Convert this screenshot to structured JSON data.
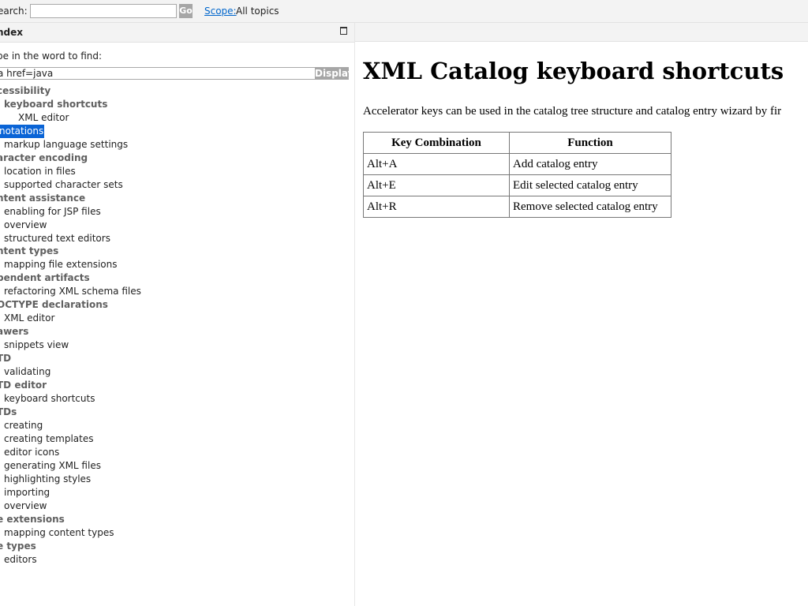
{
  "search_bar": {
    "label": "earch:",
    "input_value": "",
    "go_label": "Go",
    "scope_link": "Scope:",
    "scope_value": "All topics"
  },
  "index": {
    "title": "ndex",
    "prompt": "pe in the word to find:",
    "input_value": "a href=java",
    "display_label": "Display",
    "entries": [
      {
        "text": "cessibility"
      },
      {
        "text": "keyboard shortcuts"
      },
      {
        "text": "XML editor"
      },
      {
        "text": "notations"
      },
      {
        "text": "markup language settings"
      },
      {
        "text": "aracter encoding"
      },
      {
        "text": "location in files"
      },
      {
        "text": "supported character sets"
      },
      {
        "text": "ntent assistance"
      },
      {
        "text": "enabling for JSP files"
      },
      {
        "text": "overview"
      },
      {
        "text": "structured text editors"
      },
      {
        "text": "ntent types"
      },
      {
        "text": "mapping file extensions"
      },
      {
        "text": "pendent artifacts"
      },
      {
        "text": "refactoring XML schema files"
      },
      {
        "text": "OCTYPE declarations"
      },
      {
        "text": "XML editor"
      },
      {
        "text": "awers"
      },
      {
        "text": "snippets view"
      },
      {
        "text": "TD"
      },
      {
        "text": "validating"
      },
      {
        "text": "TD editor"
      },
      {
        "text": "keyboard shortcuts"
      },
      {
        "text": "TDs"
      },
      {
        "text": "creating"
      },
      {
        "text": "creating templates"
      },
      {
        "text": "editor icons"
      },
      {
        "text": "generating XML files"
      },
      {
        "text": "highlighting styles"
      },
      {
        "text": "importing"
      },
      {
        "text": "overview"
      },
      {
        "text": "e extensions"
      },
      {
        "text": "mapping content types"
      },
      {
        "text": "e types"
      },
      {
        "text": "editors"
      }
    ]
  },
  "content": {
    "title": "XML Catalog keyboard shortcuts",
    "intro": "Accelerator keys can be used in the catalog tree structure and catalog entry wizard by fir",
    "table": {
      "headers": [
        "Key Combination",
        "Function"
      ],
      "rows": [
        [
          "Alt+A",
          "Add catalog entry"
        ],
        [
          "Alt+E",
          "Edit selected catalog entry"
        ],
        [
          "Alt+R",
          "Remove selected catalog entry"
        ]
      ]
    }
  }
}
